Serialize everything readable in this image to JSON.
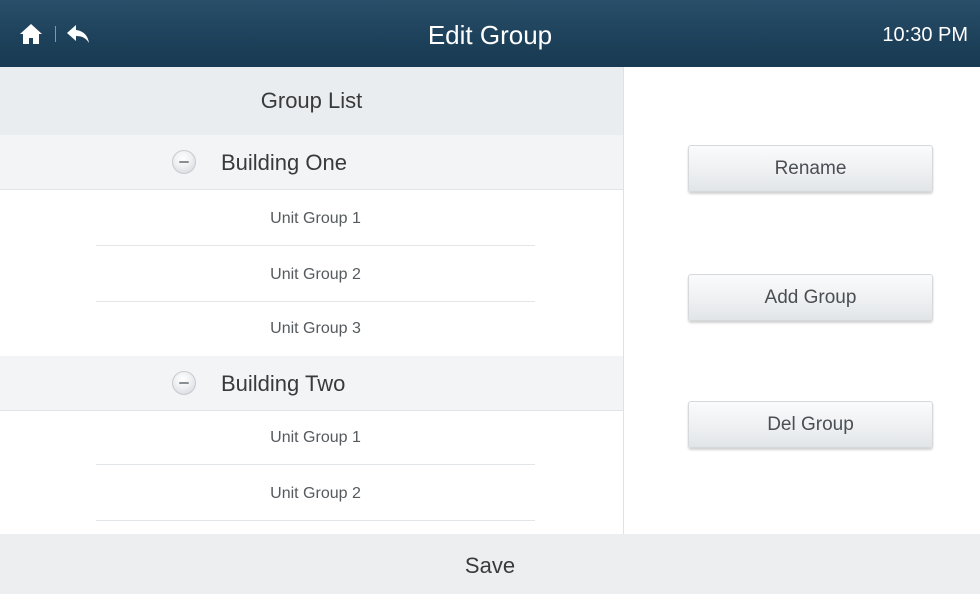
{
  "header": {
    "title": "Edit Group",
    "time": "10:30 PM",
    "home_icon": "home-icon",
    "back_icon": "back-arrow-icon"
  },
  "group_list": {
    "title": "Group List",
    "buildings": [
      {
        "name": "Building One",
        "expanded": true,
        "units": [
          "Unit Group 1",
          "Unit Group 2",
          "Unit Group 3"
        ]
      },
      {
        "name": "Building Two",
        "expanded": true,
        "units": [
          "Unit Group 1",
          "Unit Group 2"
        ]
      }
    ]
  },
  "actions": {
    "rename": "Rename",
    "add_group": "Add Group",
    "del_group": "Del Group"
  },
  "footer": {
    "save": "Save"
  },
  "colors": {
    "header_bg": "#1e425b",
    "panel_bg": "#eaedf0",
    "text": "#3a3a3a"
  }
}
